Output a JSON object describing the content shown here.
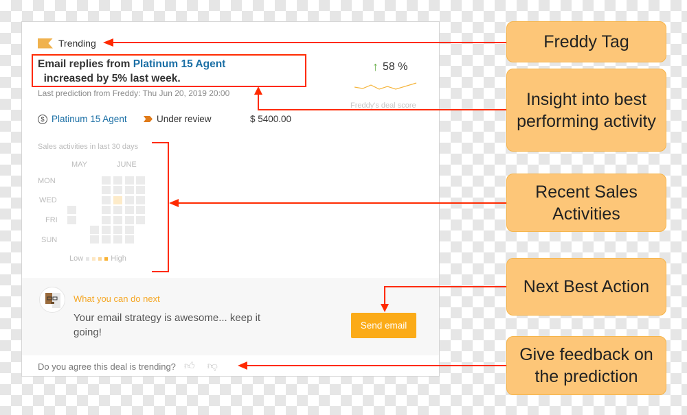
{
  "card": {
    "tag": "Trending",
    "headline_pre": "Email replies from ",
    "headline_link": "Platinum 15 Agent",
    "headline_post": "  increased by 5% last week.",
    "prediction": "Last prediction from Freddy: Thu Jun 20, 2019 20:00",
    "score": "58 %",
    "score_trend": "up",
    "score_label": "Freddy's deal score",
    "deal_name": "Platinum 15 Agent",
    "stage": "Under review",
    "amount": "$ 5400.00",
    "heatmap": {
      "title": "Sales activities in last 30 days",
      "months": [
        "MAY",
        "JUNE"
      ],
      "days": [
        "MON",
        "WED",
        "FRI",
        "SUN"
      ],
      "legend_low": "Low",
      "legend_high": "High",
      "cells": [
        [
          0,
          3
        ],
        [
          0,
          4
        ],
        [
          0,
          5
        ],
        [
          0,
          6
        ],
        [
          1,
          3
        ],
        [
          1,
          4
        ],
        [
          1,
          5
        ],
        [
          1,
          6
        ],
        [
          2,
          3
        ],
        [
          2,
          4,
          "high"
        ],
        [
          2,
          5
        ],
        [
          2,
          6
        ],
        [
          3,
          0
        ],
        [
          3,
          3
        ],
        [
          3,
          4
        ],
        [
          3,
          5
        ],
        [
          3,
          6
        ],
        [
          4,
          0
        ],
        [
          4,
          3
        ],
        [
          4,
          4
        ],
        [
          4,
          5
        ],
        [
          4,
          6
        ],
        [
          5,
          2
        ],
        [
          5,
          3
        ],
        [
          5,
          4
        ],
        [
          5,
          5
        ],
        [
          6,
          2
        ],
        [
          6,
          3
        ],
        [
          6,
          4
        ],
        [
          6,
          5
        ]
      ]
    },
    "nba": {
      "title": "What you can do next",
      "message": "Your email strategy is awesome... keep it going!",
      "button": "Send email"
    },
    "feedback": "Do you agree this deal is trending?"
  },
  "callouts": [
    "Freddy Tag",
    "Insight into best performing activity",
    "Recent Sales Activities",
    "Next Best Action",
    "Give feedback on the prediction"
  ],
  "colors": {
    "accent": "#fbab18",
    "link": "#1b6fa5",
    "callout": "#fdc678",
    "annotation": "#ff2a00"
  }
}
